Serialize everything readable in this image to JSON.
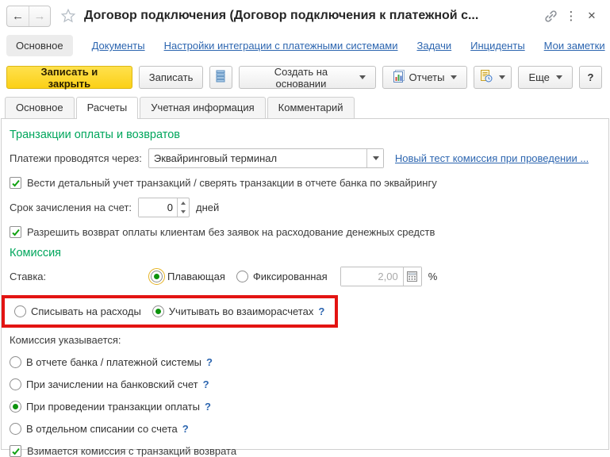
{
  "colors": {
    "accent_yellow": "#fbd016",
    "section_green": "#00a65c",
    "link_blue": "#2d66b0",
    "annotation_red": "#e31412",
    "radio_green": "#0d930d"
  },
  "icons": {
    "back": "←",
    "forward": "→",
    "kebab": "⋮",
    "close": "✕",
    "help": "?"
  },
  "titlebar": {
    "title": "Договор подключения (Договор подключения к платежной с..."
  },
  "nav": {
    "items": [
      {
        "label": "Основное"
      },
      {
        "label": "Документы"
      },
      {
        "label": "Настройки интеграции с платежными системами"
      },
      {
        "label": "Задачи"
      },
      {
        "label": "Инциденты"
      },
      {
        "label": "Мои заметки"
      }
    ]
  },
  "toolbar": {
    "save_close": "Записать и закрыть",
    "save": "Записать",
    "create_based": "Создать на основании",
    "reports": "Отчеты",
    "more": "Еще",
    "help": "?"
  },
  "tabs": {
    "items": [
      {
        "label": "Основное"
      },
      {
        "label": "Расчеты"
      },
      {
        "label": "Учетная информация"
      },
      {
        "label": "Комментарий"
      }
    ]
  },
  "form": {
    "transactions": {
      "title": "Транзакции оплаты и возвратов",
      "payments_label": "Платежи проводятся через:",
      "payments_value": "Эквайринговый терминал",
      "link": "Новый тест комиссия при проведении ...",
      "cb_detail": "Вести детальный учет транзакций / сверять транзакции в отчете банка по эквайрингу",
      "term_label": "Срок зачисления на счет:",
      "term_value": "0",
      "term_suffix": "дней",
      "cb_refund": "Разрешить возврат оплаты клиентам без заявок на расходование денежных средств"
    },
    "commission": {
      "title": "Комиссия",
      "rate_label": "Ставка:",
      "rate_float": "Плавающая",
      "rate_fixed": "Фиксированная",
      "rate_value": "2,00",
      "rate_suffix": "%",
      "opt_expenses": "Списывать на расходы",
      "opt_mutual": "Учитывать во взаиморасчетах",
      "help_mark": "?",
      "specified_label": "Комиссия указывается:",
      "opt_bank_report": "В отчете банка / платежной системы",
      "opt_bank_account": "При зачислении на банковский счет",
      "opt_payment_tx": "При проведении транзакции оплаты",
      "opt_separate": "В отдельном списании со счета",
      "cb_return": "Взимается комиссия с транзакций возврата"
    }
  }
}
